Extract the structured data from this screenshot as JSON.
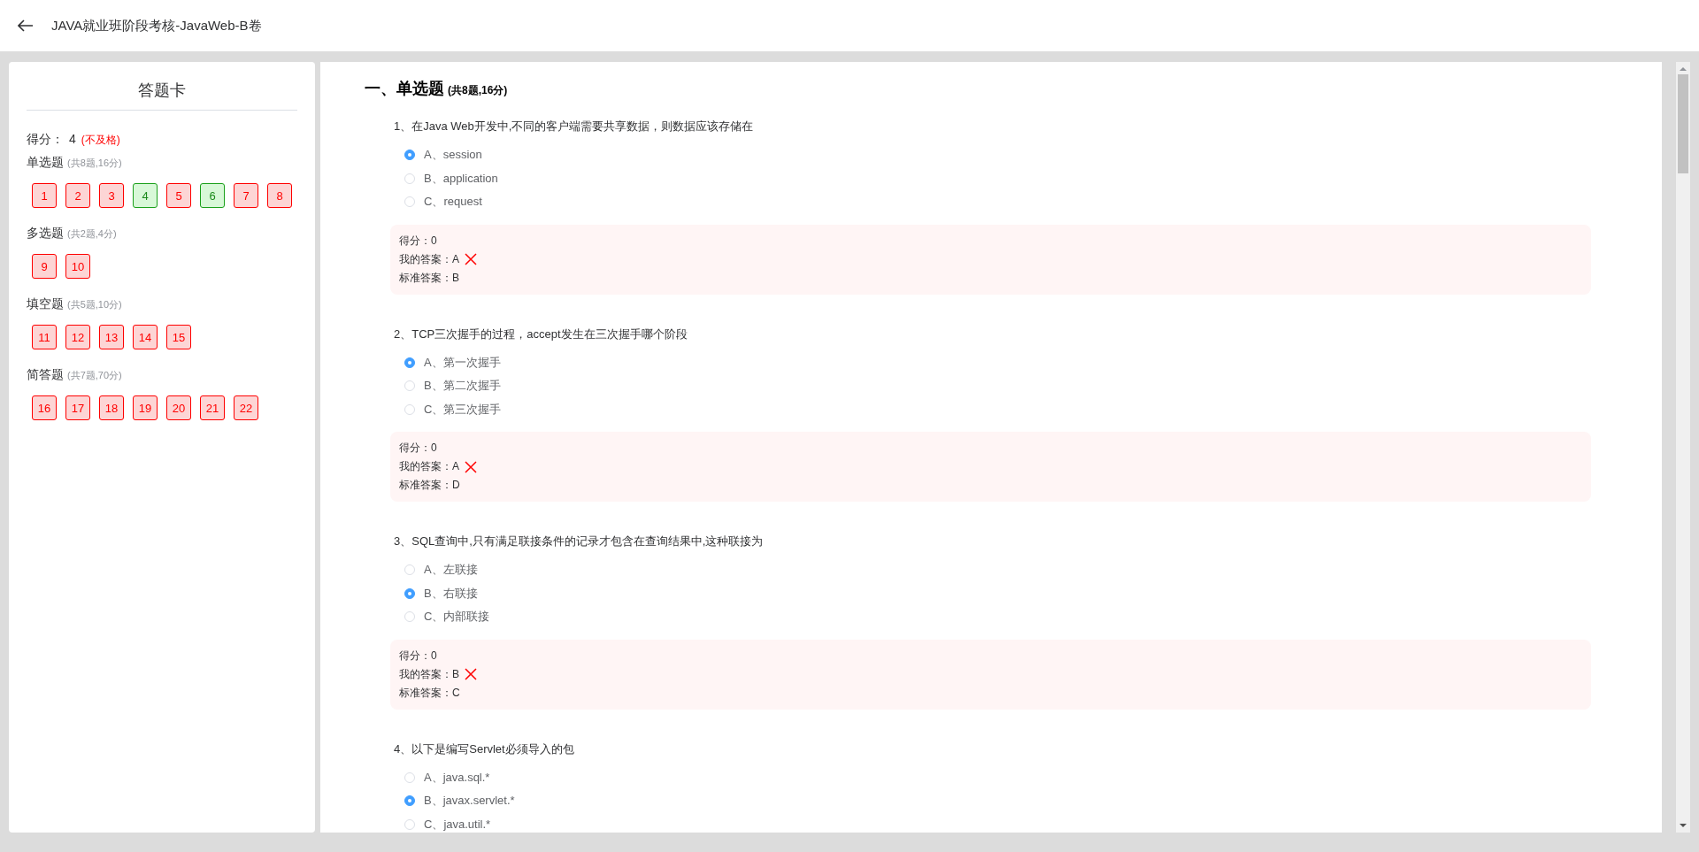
{
  "header": {
    "title": "JAVA就业班阶段考核-JavaWeb-B卷"
  },
  "answer_card": {
    "title": "答题卡",
    "score_label": "得分：",
    "score": "4",
    "verdict": "(不及格)",
    "groups": [
      {
        "name": "单选题",
        "summary": "(共8题,16分)",
        "items": [
          {
            "number": "1",
            "correct": false
          },
          {
            "number": "2",
            "correct": false
          },
          {
            "number": "3",
            "correct": false
          },
          {
            "number": "4",
            "correct": true
          },
          {
            "number": "5",
            "correct": false
          },
          {
            "number": "6",
            "correct": true
          },
          {
            "number": "7",
            "correct": false
          },
          {
            "number": "8",
            "correct": false
          }
        ]
      },
      {
        "name": "多选题",
        "summary": "(共2题,4分)",
        "items": [
          {
            "number": "9",
            "correct": false
          },
          {
            "number": "10",
            "correct": false
          }
        ]
      },
      {
        "name": "填空题",
        "summary": "(共5题,10分)",
        "items": [
          {
            "number": "11",
            "correct": false
          },
          {
            "number": "12",
            "correct": false
          },
          {
            "number": "13",
            "correct": false
          },
          {
            "number": "14",
            "correct": false
          },
          {
            "number": "15",
            "correct": false
          }
        ]
      },
      {
        "name": "简答题",
        "summary": "(共7题,70分)",
        "items": [
          {
            "number": "16",
            "correct": false
          },
          {
            "number": "17",
            "correct": false
          },
          {
            "number": "18",
            "correct": false
          },
          {
            "number": "19",
            "correct": false
          },
          {
            "number": "20",
            "correct": false
          },
          {
            "number": "21",
            "correct": false
          },
          {
            "number": "22",
            "correct": false
          }
        ]
      }
    ]
  },
  "section": {
    "heading": "一、单选题",
    "summary": "(共8题,16分)",
    "questions": [
      {
        "text": "1、在Java Web开发中,不同的客户端需要共享数据，则数据应该存储在",
        "options": [
          {
            "label": "A、session",
            "selected": true
          },
          {
            "label": "B、application",
            "selected": false
          },
          {
            "label": "C、request",
            "selected": false
          }
        ],
        "result": {
          "score": "得分：0",
          "my_answer": "我的答案：A",
          "correct": false,
          "standard": "标准答案：B"
        }
      },
      {
        "text": "2、TCP三次握手的过程，accept发生在三次握手哪个阶段",
        "options": [
          {
            "label": "A、第一次握手",
            "selected": true
          },
          {
            "label": "B、第二次握手",
            "selected": false
          },
          {
            "label": "C、第三次握手",
            "selected": false
          }
        ],
        "result": {
          "score": "得分：0",
          "my_answer": "我的答案：A",
          "correct": false,
          "standard": "标准答案：D"
        }
      },
      {
        "text": "3、SQL查询中,只有满足联接条件的记录才包含在查询结果中,这种联接为",
        "options": [
          {
            "label": "A、左联接",
            "selected": false
          },
          {
            "label": "B、右联接",
            "selected": true
          },
          {
            "label": "C、内部联接",
            "selected": false
          }
        ],
        "result": {
          "score": "得分：0",
          "my_answer": "我的答案：B",
          "correct": false,
          "standard": "标准答案：C"
        }
      },
      {
        "text": "4、以下是编写Servlet必须导入的包",
        "options": [
          {
            "label": "A、java.sql.*",
            "selected": false
          },
          {
            "label": "B、javax.servlet.*",
            "selected": true
          },
          {
            "label": "C、java.util.*",
            "selected": false
          }
        ]
      }
    ]
  }
}
